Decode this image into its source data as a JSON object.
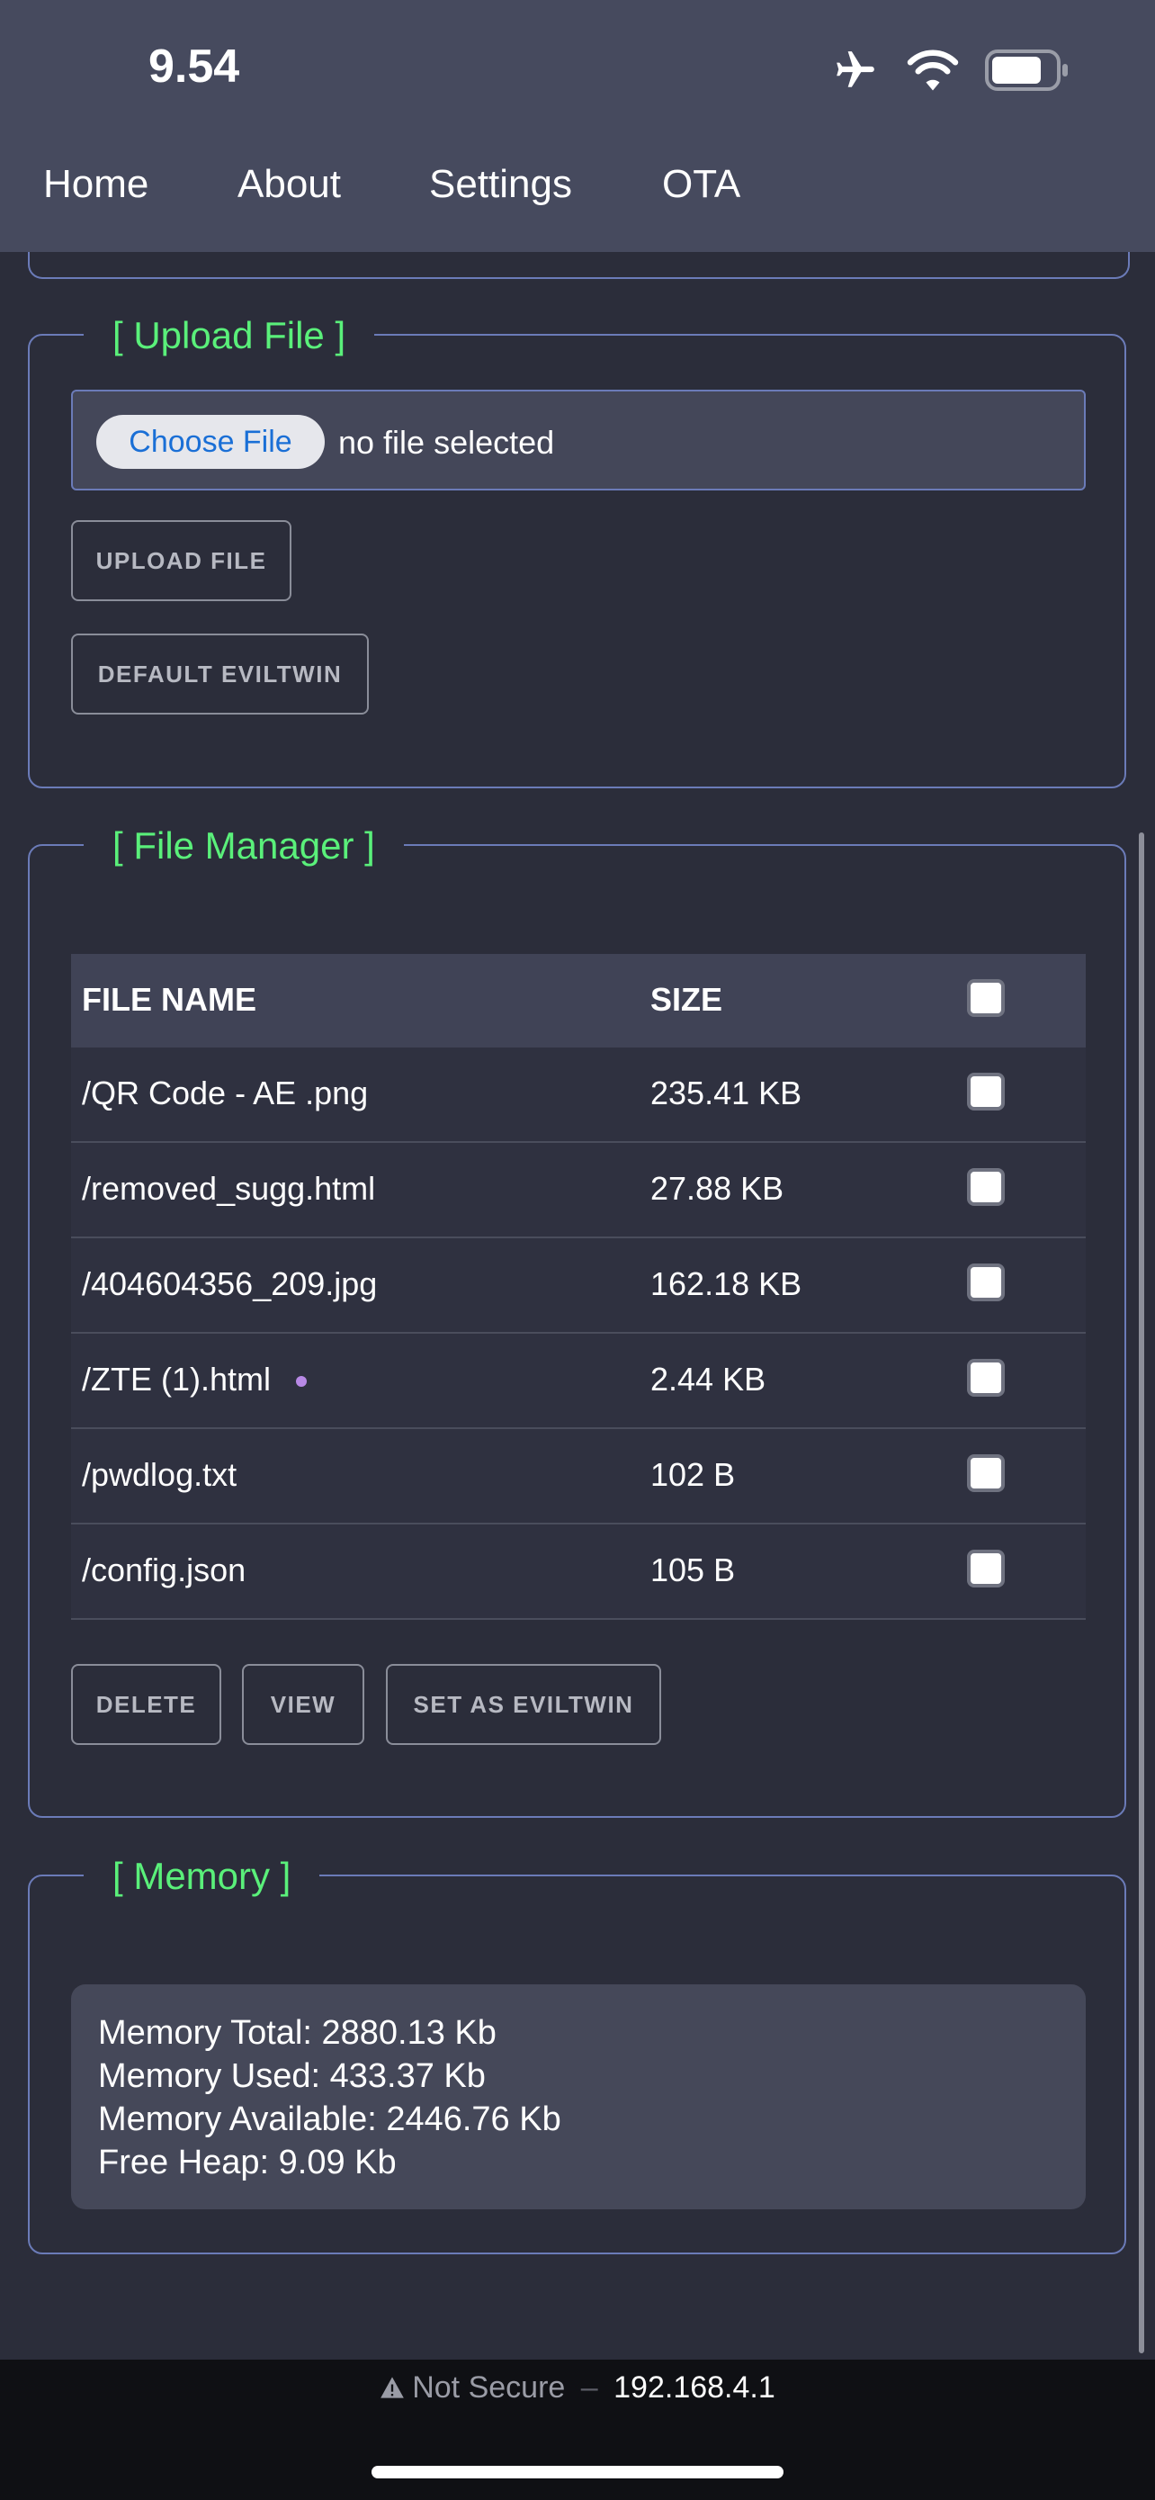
{
  "status_bar": {
    "time": "9.54"
  },
  "nav": {
    "items": [
      "Home",
      "About",
      "Settings",
      "OTA"
    ]
  },
  "upload": {
    "legend": "[ Upload File ]",
    "choose_label": "Choose File",
    "no_file": "no file selected",
    "upload_btn": "UPLOAD FILE",
    "default_btn": "DEFAULT EVILTWIN"
  },
  "file_manager": {
    "legend": "[ File Manager ]",
    "headers": {
      "name": "FILE NAME",
      "size": "SIZE"
    },
    "rows": [
      {
        "name": "/QR Code - AE .png",
        "size": "235.41 KB"
      },
      {
        "name": "/removed_sugg.html",
        "size": "27.88 KB"
      },
      {
        "name": "/404604356_209.jpg",
        "size": "162.18 KB"
      },
      {
        "name": "/ZTE (1).html",
        "size": "2.44 KB"
      },
      {
        "name": "/pwdlog.txt",
        "size": "102 B"
      },
      {
        "name": "/config.json",
        "size": "105 B"
      }
    ],
    "delete_btn": "DELETE",
    "view_btn": "VIEW",
    "set_btn": "SET AS EVILTWIN"
  },
  "memory": {
    "legend": "[ Memory ]",
    "lines": [
      "Memory Total: 2880.13 Kb",
      "Memory Used: 433.37 Kb",
      "Memory Available: 2446.76 Kb",
      "Free Heap: 9.09 Kb"
    ]
  },
  "address_bar": {
    "security": "Not Secure",
    "separator": "–",
    "host": "192.168.4.1"
  },
  "colors": {
    "accent_green": "#5af07a",
    "panel_border": "#6b7bb8",
    "background": "#2b2d3a",
    "nav_bg": "#464a5e"
  }
}
